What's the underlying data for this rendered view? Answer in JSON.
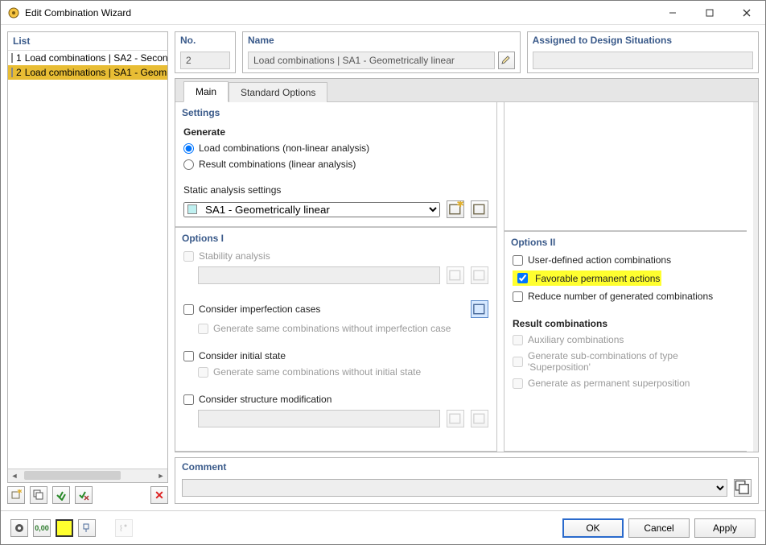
{
  "window": {
    "title": "Edit Combination Wizard"
  },
  "list": {
    "header": "List",
    "items": [
      {
        "num": "1",
        "label": "Load combinations | SA2 - Secon",
        "swatch": "#bff0f0",
        "selected": false
      },
      {
        "num": "2",
        "label": "Load combinations | SA1 - Geom",
        "swatch": "#e8bd34",
        "selected": true
      }
    ]
  },
  "no": {
    "label": "No.",
    "value": "2"
  },
  "name": {
    "label": "Name",
    "value": "Load combinations | SA1 - Geometrically linear"
  },
  "assign": {
    "label": "Assigned to Design Situations",
    "value": ""
  },
  "tabs": {
    "main": "Main",
    "standard": "Standard Options"
  },
  "settings": {
    "header": "Settings",
    "generate_label": "Generate",
    "radio1": "Load combinations (non-linear analysis)",
    "radio2": "Result combinations (linear analysis)",
    "static_label": "Static analysis settings",
    "static_value": "    SA1 - Geometrically linear"
  },
  "options1": {
    "header": "Options I",
    "stability": "Stability analysis",
    "imperf": "Consider imperfection cases",
    "imperf_sub": "Generate same combinations without imperfection case",
    "initial": "Consider initial state",
    "initial_sub": "Generate same combinations without initial state",
    "struct": "Consider structure modification"
  },
  "options2": {
    "header": "Options II",
    "user_def": "User-defined action combinations",
    "fav": "Favorable permanent actions",
    "reduce": "Reduce number of generated combinations",
    "result_hdr": "Result combinations",
    "aux": "Auxiliary combinations",
    "sub": "Generate sub-combinations of type 'Superposition'",
    "perm": "Generate as permanent superposition"
  },
  "comment": {
    "header": "Comment",
    "value": ""
  },
  "footer": {
    "ok": "OK",
    "cancel": "Cancel",
    "apply": "Apply"
  }
}
